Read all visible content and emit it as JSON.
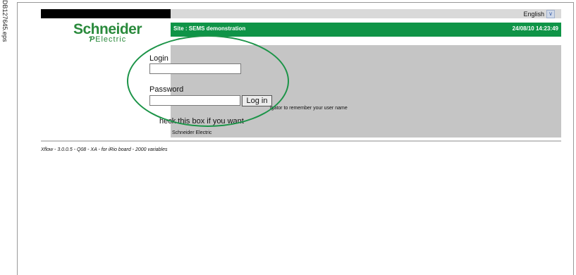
{
  "side_caption": "DB127645.eps",
  "header": {
    "language": "English",
    "language_dropdown_icon": "chevron-down-icon"
  },
  "brand": {
    "name_line1": "Schneider",
    "name_line2": "Electric"
  },
  "site_bar": {
    "site": "Site : SEMS demonstration",
    "datetime": "24/08/10 14:23:49"
  },
  "login_form": {
    "login_label": "Login",
    "login_value": "",
    "password_label": "Password",
    "password_value": "",
    "submit_label": "Log in",
    "remember_fragment": "igator to remember your user name",
    "remember_text": "heck this box if you want",
    "footer": "Schneider Electric"
  },
  "version_text": "Xflow - 3.0.0.5 - Q08 - XA - for iRio board - 2000 variables",
  "colors": {
    "accent_green": "#0f9447",
    "panel_gray": "#c5c5c5",
    "highlight_ring": "#1c9448"
  }
}
